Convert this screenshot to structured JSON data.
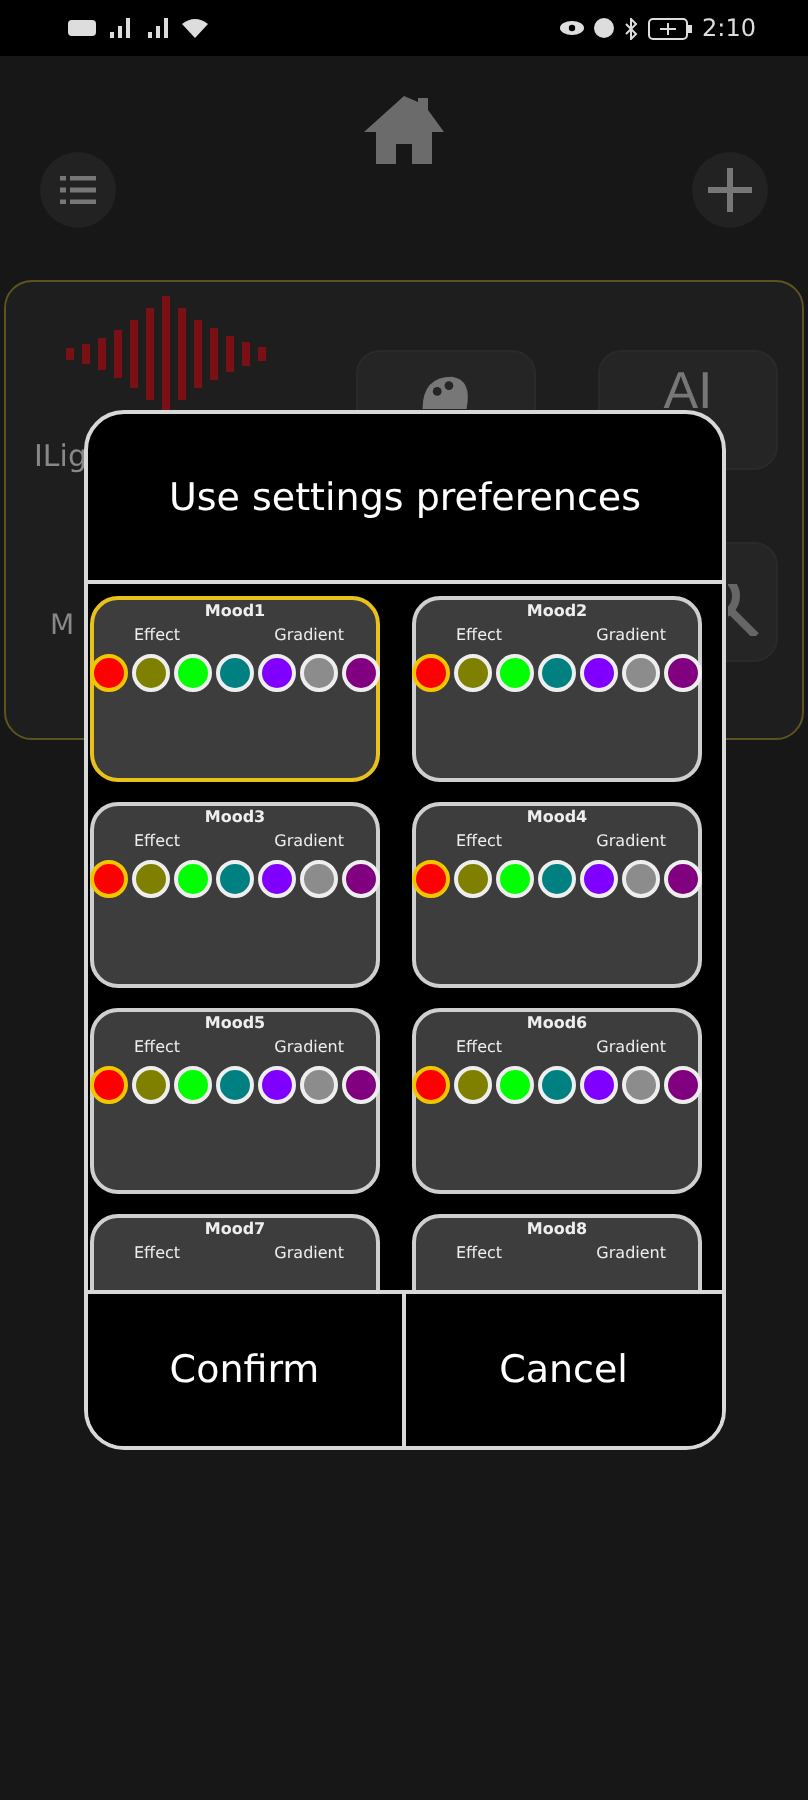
{
  "status_bar": {
    "time": "2:10"
  },
  "device_card": {
    "name": "ILig",
    "mode_label": "M",
    "ai_button": "AI"
  },
  "dialog": {
    "title": "Use settings preferences",
    "moods": [
      {
        "name": "Mood1",
        "selected": true,
        "effect_label": "Effect",
        "gradient_label": "Gradient",
        "colors": [
          {
            "color": "#ff0000",
            "selected": true
          },
          {
            "color": "#808000",
            "selected": false
          },
          {
            "color": "#00ff00",
            "selected": false
          },
          {
            "color": "#008080",
            "selected": false
          },
          {
            "color": "#8000ff",
            "selected": false
          },
          {
            "color": "#8c8c8c",
            "selected": false
          },
          {
            "color": "#800080",
            "selected": false
          }
        ]
      },
      {
        "name": "Mood2",
        "selected": false,
        "effect_label": "Effect",
        "gradient_label": "Gradient",
        "colors": [
          {
            "color": "#ff0000",
            "selected": true
          },
          {
            "color": "#808000",
            "selected": false
          },
          {
            "color": "#00ff00",
            "selected": false
          },
          {
            "color": "#008080",
            "selected": false
          },
          {
            "color": "#8000ff",
            "selected": false
          },
          {
            "color": "#8c8c8c",
            "selected": false
          },
          {
            "color": "#800080",
            "selected": false
          }
        ]
      },
      {
        "name": "Mood3",
        "selected": false,
        "effect_label": "Effect",
        "gradient_label": "Gradient",
        "colors": [
          {
            "color": "#ff0000",
            "selected": true
          },
          {
            "color": "#808000",
            "selected": false
          },
          {
            "color": "#00ff00",
            "selected": false
          },
          {
            "color": "#008080",
            "selected": false
          },
          {
            "color": "#8000ff",
            "selected": false
          },
          {
            "color": "#8c8c8c",
            "selected": false
          },
          {
            "color": "#800080",
            "selected": false
          }
        ]
      },
      {
        "name": "Mood4",
        "selected": false,
        "effect_label": "Effect",
        "gradient_label": "Gradient",
        "colors": [
          {
            "color": "#ff0000",
            "selected": true
          },
          {
            "color": "#808000",
            "selected": false
          },
          {
            "color": "#00ff00",
            "selected": false
          },
          {
            "color": "#008080",
            "selected": false
          },
          {
            "color": "#8000ff",
            "selected": false
          },
          {
            "color": "#8c8c8c",
            "selected": false
          },
          {
            "color": "#800080",
            "selected": false
          }
        ]
      },
      {
        "name": "Mood5",
        "selected": false,
        "effect_label": "Effect",
        "gradient_label": "Gradient",
        "colors": [
          {
            "color": "#ff0000",
            "selected": true
          },
          {
            "color": "#808000",
            "selected": false
          },
          {
            "color": "#00ff00",
            "selected": false
          },
          {
            "color": "#008080",
            "selected": false
          },
          {
            "color": "#8000ff",
            "selected": false
          },
          {
            "color": "#8c8c8c",
            "selected": false
          },
          {
            "color": "#800080",
            "selected": false
          }
        ]
      },
      {
        "name": "Mood6",
        "selected": false,
        "effect_label": "Effect",
        "gradient_label": "Gradient",
        "colors": [
          {
            "color": "#ff0000",
            "selected": true
          },
          {
            "color": "#808000",
            "selected": false
          },
          {
            "color": "#00ff00",
            "selected": false
          },
          {
            "color": "#008080",
            "selected": false
          },
          {
            "color": "#8000ff",
            "selected": false
          },
          {
            "color": "#8c8c8c",
            "selected": false
          },
          {
            "color": "#800080",
            "selected": false
          }
        ]
      },
      {
        "name": "Mood7",
        "selected": false,
        "effect_label": "Effect",
        "gradient_label": "Gradient"
      },
      {
        "name": "Mood8",
        "selected": false,
        "effect_label": "Effect",
        "gradient_label": "Gradient"
      }
    ],
    "buttons": [
      "Confirm",
      "Cancel"
    ]
  }
}
